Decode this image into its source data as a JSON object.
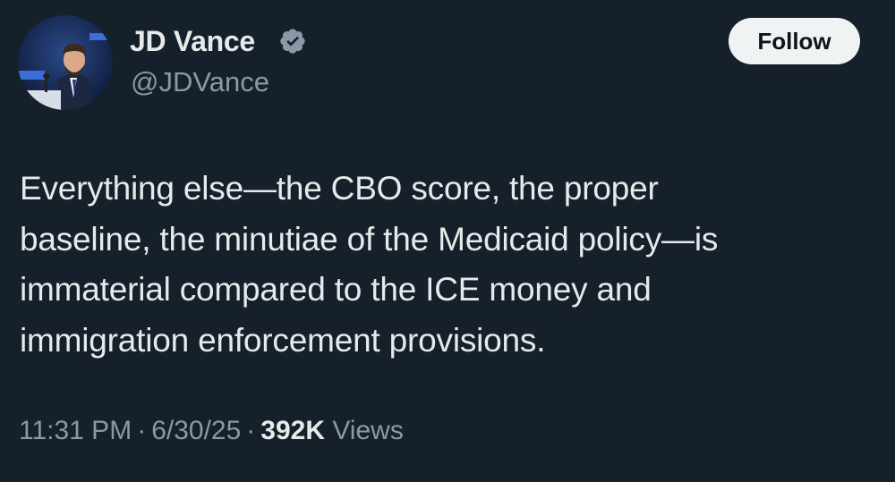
{
  "author": {
    "display_name": "JD Vance",
    "handle": "@JDVance",
    "verified_icon": "verified-badge-icon",
    "verified_color": "#8b98a5"
  },
  "follow_button": {
    "label": "Follow"
  },
  "tweet": {
    "text_lines": [
      "Everything else—the CBO score, the proper",
      "baseline, the minutiae of the Medicaid policy—is",
      "immaterial compared to the ICE money and",
      "immigration enforcement provisions."
    ]
  },
  "meta": {
    "time": "11:31 PM",
    "date": "6/30/25",
    "separator": "·",
    "views_count": "392K",
    "views_label": "Views"
  },
  "colors": {
    "background": "#15202b",
    "primary_text": "#e7e9ea",
    "secondary_text": "#8b98a5",
    "button_bg": "#eff3f4"
  }
}
